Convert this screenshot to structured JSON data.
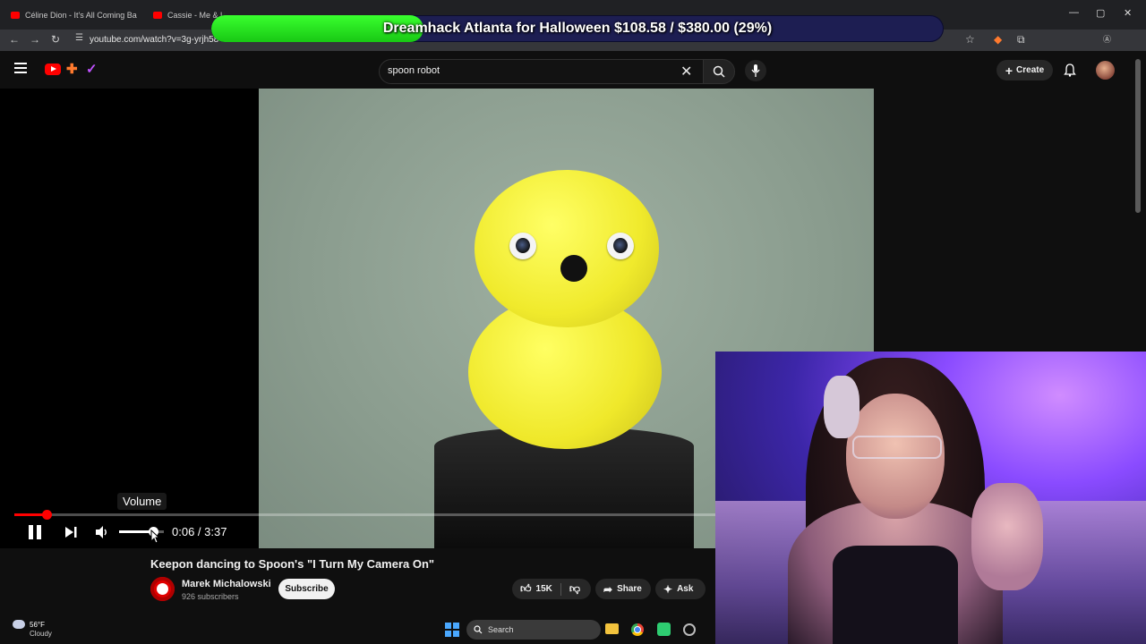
{
  "browser": {
    "tabs": [
      {
        "label": "Céline Dion - It's All Coming Ba"
      },
      {
        "label": "Cassie - Me & U"
      },
      {
        "label": ""
      },
      {
        "label": ""
      }
    ],
    "url": "youtube.com/watch?v=3g-yrjh58"
  },
  "donation": {
    "text": "Dreamhack Atlanta for Halloween $108.58 / $380.00 (29%)",
    "progress_percent": 29
  },
  "youtube": {
    "search_value": "spoon robot",
    "create_label": "Create"
  },
  "player": {
    "tooltip": "Volume",
    "time": "0:06 / 3:37",
    "progress_fraction": 0.046,
    "volume_fraction": 0.75
  },
  "video": {
    "title": "Keepon dancing to Spoon's \"I Turn My Camera On\"",
    "channel_name": "Marek Michalowski",
    "subscribers": "926 subscribers",
    "subscribe_label": "Subscribe",
    "likes": "15K",
    "share_label": "Share",
    "ask_label": "Ask"
  },
  "taskbar": {
    "temperature": "56°F",
    "condition": "Cloudy",
    "search_label": "Search"
  },
  "colors": {
    "accent_red": "#ff0000",
    "donation_green": "#2ee82a",
    "donation_bg": "#1d1e52"
  },
  "icons": [
    "menu-icon",
    "search-icon",
    "close-icon",
    "mic-icon",
    "plus-icon",
    "bell-icon",
    "pause-icon",
    "next-icon",
    "volume-icon",
    "like-icon",
    "dislike-icon",
    "share-icon",
    "sparkle-icon",
    "windows-icon",
    "folder-icon",
    "chrome-icon"
  ]
}
